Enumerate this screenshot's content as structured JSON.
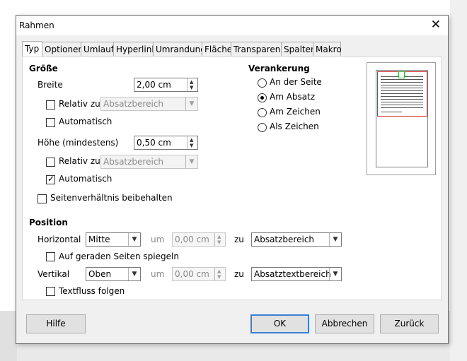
{
  "dialog": {
    "title": "Rahmen",
    "close_glyph": "✕"
  },
  "tabs": [
    {
      "label": "Typ",
      "active": true
    },
    {
      "label": "Optionen"
    },
    {
      "label": "Umlauf"
    },
    {
      "label": "Hyperlink"
    },
    {
      "label": "Umrandung"
    },
    {
      "label": "Fläche"
    },
    {
      "label": "Transparenz"
    },
    {
      "label": "Spalten"
    },
    {
      "label": "Makro"
    }
  ],
  "size": {
    "heading": "Größe",
    "width_label": "Breite",
    "width_value": "2,00 cm",
    "relative_label": "Relativ zu",
    "relative_value": "Absatzbereich",
    "auto_label": "Automatisch",
    "height_label": "Höhe (mindestens)",
    "height_value": "0,50 cm",
    "relative2_label": "Relativ zu",
    "relative2_value": "Absatzbereich",
    "auto2_label": "Automatisch",
    "auto2_checked": true,
    "keep_ratio_label": "Seitenverhältnis beibehalten"
  },
  "anchor": {
    "heading": "Verankerung",
    "options": [
      {
        "label": "An der Seite",
        "selected": false
      },
      {
        "label": "Am Absatz",
        "selected": true
      },
      {
        "label": "Am Zeichen",
        "selected": false
      },
      {
        "label": "Als Zeichen",
        "selected": false
      }
    ]
  },
  "position": {
    "heading": "Position",
    "horizontal_label": "Horizontal",
    "horizontal_value": "Mitte",
    "um_label": "um",
    "horizontal_by": "0,00 cm",
    "zu_label": "zu",
    "horizontal_to": "Absatzbereich",
    "mirror_label": "Auf geraden Seiten spiegeln",
    "vertical_label": "Vertikal",
    "vertical_value": "Oben",
    "um2_label": "um",
    "vertical_by": "0,00 cm",
    "zu2_label": "zu",
    "vertical_to": "Absatztextbereich",
    "follow_label": "Textfluss folgen"
  },
  "buttons": {
    "help": "Hilfe",
    "ok": "OK",
    "cancel": "Abbrechen",
    "reset": "Zurück"
  },
  "glyphs": {
    "check": "✓",
    "up": "▲",
    "down": "▼",
    "dropdown": "▼"
  }
}
